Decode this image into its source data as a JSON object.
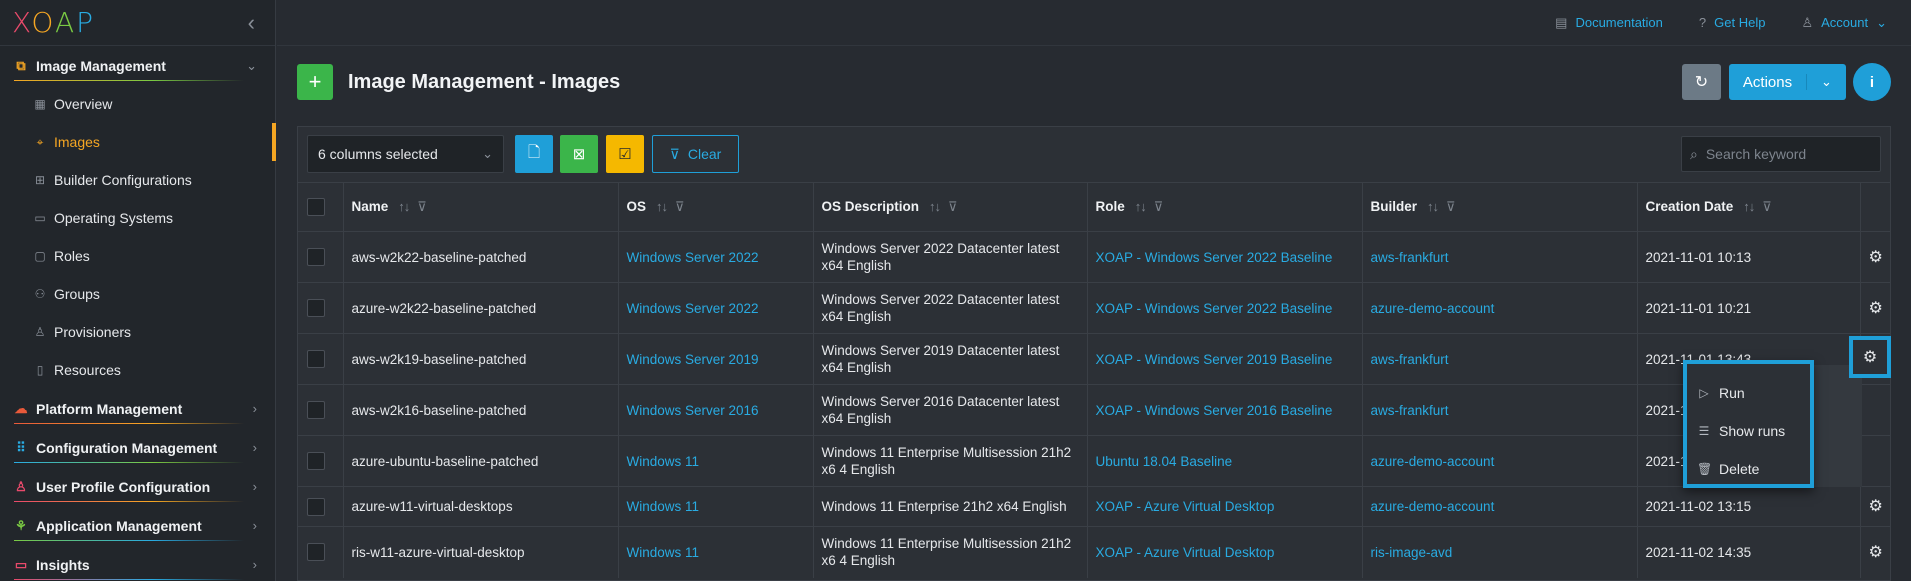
{
  "app": {
    "logo_letters": [
      "X",
      "O",
      "A",
      "P"
    ],
    "collapse_icon": "chevron-left-icon"
  },
  "topbar": {
    "documentation": "Documentation",
    "get_help": "Get Help",
    "account": "Account"
  },
  "sidebar": {
    "sections": [
      {
        "label": "Image Management",
        "icon": "copy-icon",
        "color1": "#f5a623",
        "color2": "#7ac943",
        "expanded": true
      },
      {
        "label": "Platform Management",
        "icon": "cloud-icon",
        "color1": "#e8593a",
        "color2": "#f5a623"
      },
      {
        "label": "Configuration Management",
        "icon": "grid-icon",
        "color1": "#29abe2",
        "color2": "#7ac943"
      },
      {
        "label": "User Profile Configuration",
        "icon": "user-icon",
        "color1": "#e84a6b",
        "color2": "#f5a623"
      },
      {
        "label": "Application Management",
        "icon": "sitemap-icon",
        "color1": "#7ac943",
        "color2": "#29abe2"
      },
      {
        "label": "Insights",
        "icon": "monitor-icon",
        "color1": "#e84a6b",
        "color2": "#29abe2"
      }
    ],
    "items": [
      {
        "label": "Overview",
        "icon": "table-icon"
      },
      {
        "label": "Images",
        "icon": "crosshair-icon",
        "active": true
      },
      {
        "label": "Builder Configurations",
        "icon": "grid-icon"
      },
      {
        "label": "Operating Systems",
        "icon": "monitor-icon"
      },
      {
        "label": "Roles",
        "icon": "window-icon"
      },
      {
        "label": "Groups",
        "icon": "users-icon"
      },
      {
        "label": "Provisioners",
        "icon": "user-icon"
      },
      {
        "label": "Resources",
        "icon": "file-icon"
      }
    ]
  },
  "header": {
    "title": "Image Management - Images",
    "actions_label": "Actions",
    "info": "i"
  },
  "toolbar": {
    "columns_selected": "6 columns selected",
    "clear_label": "Clear",
    "search_placeholder": "Search keyword"
  },
  "table": {
    "columns": [
      "Name",
      "OS",
      "OS Description",
      "Role",
      "Builder",
      "Creation Date"
    ],
    "rows": [
      {
        "name": "aws-w2k22-baseline-patched",
        "os": "Windows Server 2022",
        "os_desc": "Windows Server 2022 Datacenter latest x64 English",
        "role": "XOAP - Windows Server 2022 Baseline",
        "builder": "aws-frankfurt",
        "date": "2021-11-01 10:13"
      },
      {
        "name": "azure-w2k22-baseline-patched",
        "os": "Windows Server 2022",
        "os_desc": "Windows Server 2022 Datacenter latest x64 English",
        "role": "XOAP - Windows Server 2022 Baseline",
        "builder": "azure-demo-account",
        "date": "2021-11-01 10:21"
      },
      {
        "name": "aws-w2k19-baseline-patched",
        "os": "Windows Server 2019",
        "os_desc": "Windows Server 2019 Datacenter latest x64 English",
        "role": "XOAP - Windows Server 2019 Baseline",
        "builder": "aws-frankfurt",
        "date": "2021-11-01 13:43"
      },
      {
        "name": "aws-w2k16-baseline-patched",
        "os": "Windows Server 2016",
        "os_desc": "Windows Server 2016 Datacenter latest x64 English",
        "role": "XOAP - Windows Server 2016 Baseline",
        "builder": "aws-frankfurt",
        "date": "2021-1"
      },
      {
        "name": "azure-ubuntu-baseline-patched",
        "os": "Windows 11",
        "os_desc": "Windows 11 Enterprise Multisession 21h2 x6 4 English",
        "role": "Ubuntu 18.04 Baseline",
        "builder": "azure-demo-account",
        "date": "2021-1"
      },
      {
        "name": "azure-w11-virtual-desktops",
        "os": "Windows 11",
        "os_desc": "Windows 11 Enterprise 21h2 x64 English",
        "role": "XOAP - Azure Virtual Desktop",
        "builder": "azure-demo-account",
        "date": "2021-11-02 13:15"
      },
      {
        "name": "ris-w11-azure-virtual-desktop",
        "os": "Windows 11",
        "os_desc": "Windows 11 Enterprise Multisession 21h2 x6 4 English",
        "role": "XOAP - Azure Virtual Desktop",
        "builder": "ris-image-avd",
        "date": "2021-11-02 14:35"
      }
    ]
  },
  "context_menu": {
    "items": [
      {
        "label": "Run",
        "icon": "play-icon"
      },
      {
        "label": "Show runs",
        "icon": "list-icon"
      },
      {
        "label": "Delete",
        "icon": "trash-icon"
      }
    ]
  },
  "colors": {
    "accent": "#1f9fd8",
    "link": "#29abe2",
    "active": "#f5a623",
    "success": "#3bb54a",
    "warning": "#f5b800"
  }
}
